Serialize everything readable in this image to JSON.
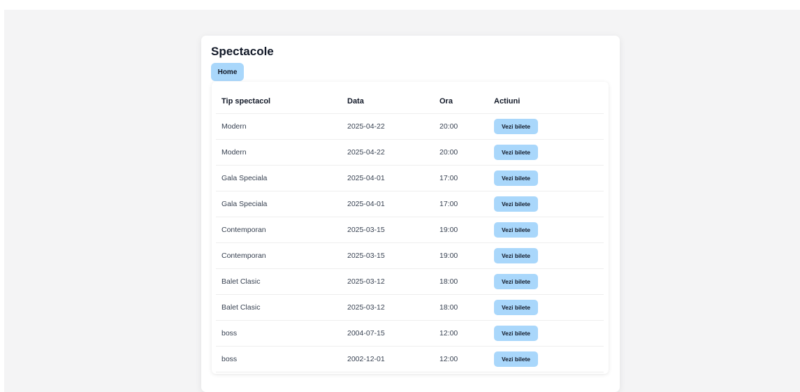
{
  "page": {
    "title": "Spectacole",
    "home_label": "Home"
  },
  "table": {
    "headers": [
      "Tip spectacol",
      "Data",
      "Ora",
      "Actiuni"
    ],
    "rows": [
      {
        "tip": "Modern",
        "data": "2025-04-22",
        "ora": "20:00",
        "action": "Vezi bilete"
      },
      {
        "tip": "Modern",
        "data": "2025-04-22",
        "ora": "20:00",
        "action": "Vezi bilete"
      },
      {
        "tip": "Gala Speciala",
        "data": "2025-04-01",
        "ora": "17:00",
        "action": "Vezi bilete"
      },
      {
        "tip": "Gala Speciala",
        "data": "2025-04-01",
        "ora": "17:00",
        "action": "Vezi bilete"
      },
      {
        "tip": "Contemporan",
        "data": "2025-03-15",
        "ora": "19:00",
        "action": "Vezi bilete"
      },
      {
        "tip": "Contemporan",
        "data": "2025-03-15",
        "ora": "19:00",
        "action": "Vezi bilete"
      },
      {
        "tip": "Balet Clasic",
        "data": "2025-03-12",
        "ora": "18:00",
        "action": "Vezi bilete"
      },
      {
        "tip": "Balet Clasic",
        "data": "2025-03-12",
        "ora": "18:00",
        "action": "Vezi bilete"
      },
      {
        "tip": "boss",
        "data": "2004-07-15",
        "ora": "12:00",
        "action": "Vezi bilete"
      },
      {
        "tip": "boss",
        "data": "2002-12-01",
        "ora": "12:00",
        "action": "Vezi bilete"
      }
    ]
  },
  "colors": {
    "button_bg": "#a9d7fb",
    "page_bg": "#f4f4f5",
    "card_bg": "#ffffff"
  }
}
